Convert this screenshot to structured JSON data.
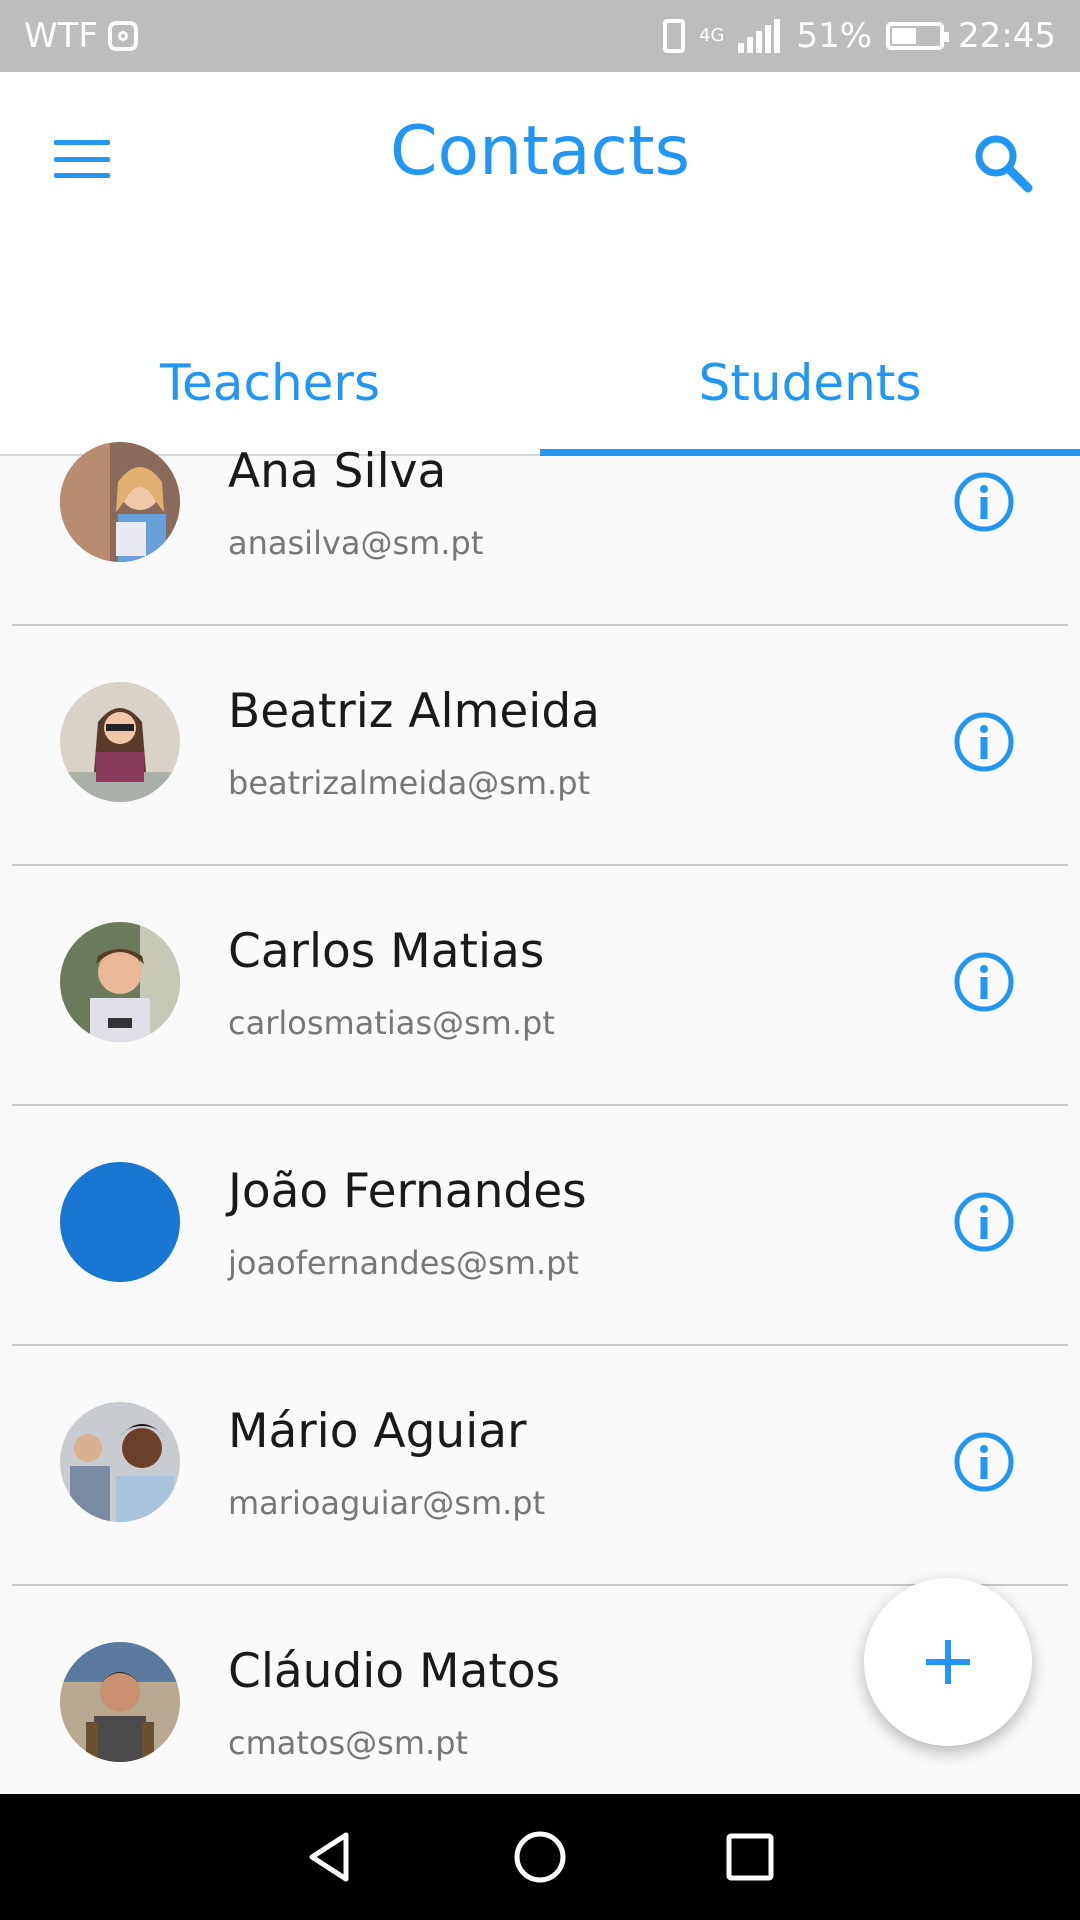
{
  "status_bar": {
    "carrier": "WTF",
    "battery_percent": "51%",
    "time": "22:45",
    "network": "4G"
  },
  "app_bar": {
    "title": "Contacts"
  },
  "tabs": [
    {
      "label": "Teachers",
      "active": false
    },
    {
      "label": "Students",
      "active": true
    }
  ],
  "contacts": [
    {
      "name": "Ana Silva",
      "email": "anasilva@sm.pt",
      "avatar": "photo"
    },
    {
      "name": "Beatriz Almeida",
      "email": "beatrizalmeida@sm.pt",
      "avatar": "photo"
    },
    {
      "name": "Carlos Matias",
      "email": "carlosmatias@sm.pt",
      "avatar": "photo"
    },
    {
      "name": "João Fernandes",
      "email": "joaofernandes@sm.pt",
      "avatar": "solid-blue"
    },
    {
      "name": "Mário Aguiar",
      "email": "marioaguiar@sm.pt",
      "avatar": "photo"
    },
    {
      "name": "Cláudio Matos",
      "email": "cmatos@sm.pt",
      "avatar": "photo"
    }
  ],
  "fab": {
    "icon": "plus-icon"
  },
  "colors": {
    "accent": "#2196f3",
    "avatar_solid": "#1976d2",
    "status_bar": "#bdbdbd",
    "nav_bar": "#000000"
  }
}
